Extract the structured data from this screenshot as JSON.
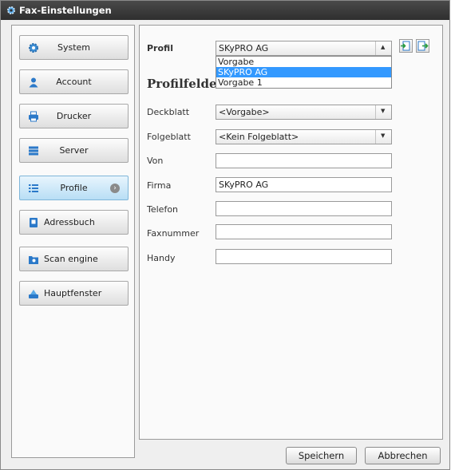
{
  "window": {
    "title": "Fax-Einstellungen"
  },
  "sidebar": {
    "items": [
      {
        "label": "System",
        "icon": "gear-icon",
        "active": false
      },
      {
        "label": "Account",
        "icon": "user-icon",
        "active": false
      },
      {
        "label": "Drucker",
        "icon": "printer-icon",
        "active": false
      },
      {
        "label": "Server",
        "icon": "server-icon",
        "active": false
      },
      {
        "label": "Profile",
        "icon": "list-icon",
        "active": true
      },
      {
        "label": "Adressbuch",
        "icon": "addressbook-icon",
        "active": false
      },
      {
        "label": "Scan engine",
        "icon": "scanner-icon",
        "active": false
      },
      {
        "label": "Hauptfenster",
        "icon": "main-window-icon",
        "active": false
      }
    ]
  },
  "profile": {
    "label": "Profil",
    "selected": "SKyPRO AG",
    "options": [
      "Vorgabe",
      "SKyPRO AG",
      "Vorgabe 1"
    ],
    "highlighted_option": "SKyPRO AG"
  },
  "profilfelder": {
    "heading": "Profilfelder",
    "deckblatt": {
      "label": "Deckblatt",
      "value": "<Vorgabe>"
    },
    "folgeblatt": {
      "label": "Folgeblatt",
      "value": "<Kein Folgeblatt>"
    },
    "von": {
      "label": "Von",
      "value": ""
    },
    "firma": {
      "label": "Firma",
      "value": "SKyPRO AG"
    },
    "telefon": {
      "label": "Telefon",
      "value": ""
    },
    "faxnummer": {
      "label": "Faxnummer",
      "value": ""
    },
    "handy": {
      "label": "Handy",
      "value": ""
    }
  },
  "buttons": {
    "save": "Speichern",
    "cancel": "Abbrechen"
  },
  "colors": {
    "titlebar": "#3a3a3a",
    "accent": "#3399ff",
    "active_nav": "#b8def5"
  }
}
